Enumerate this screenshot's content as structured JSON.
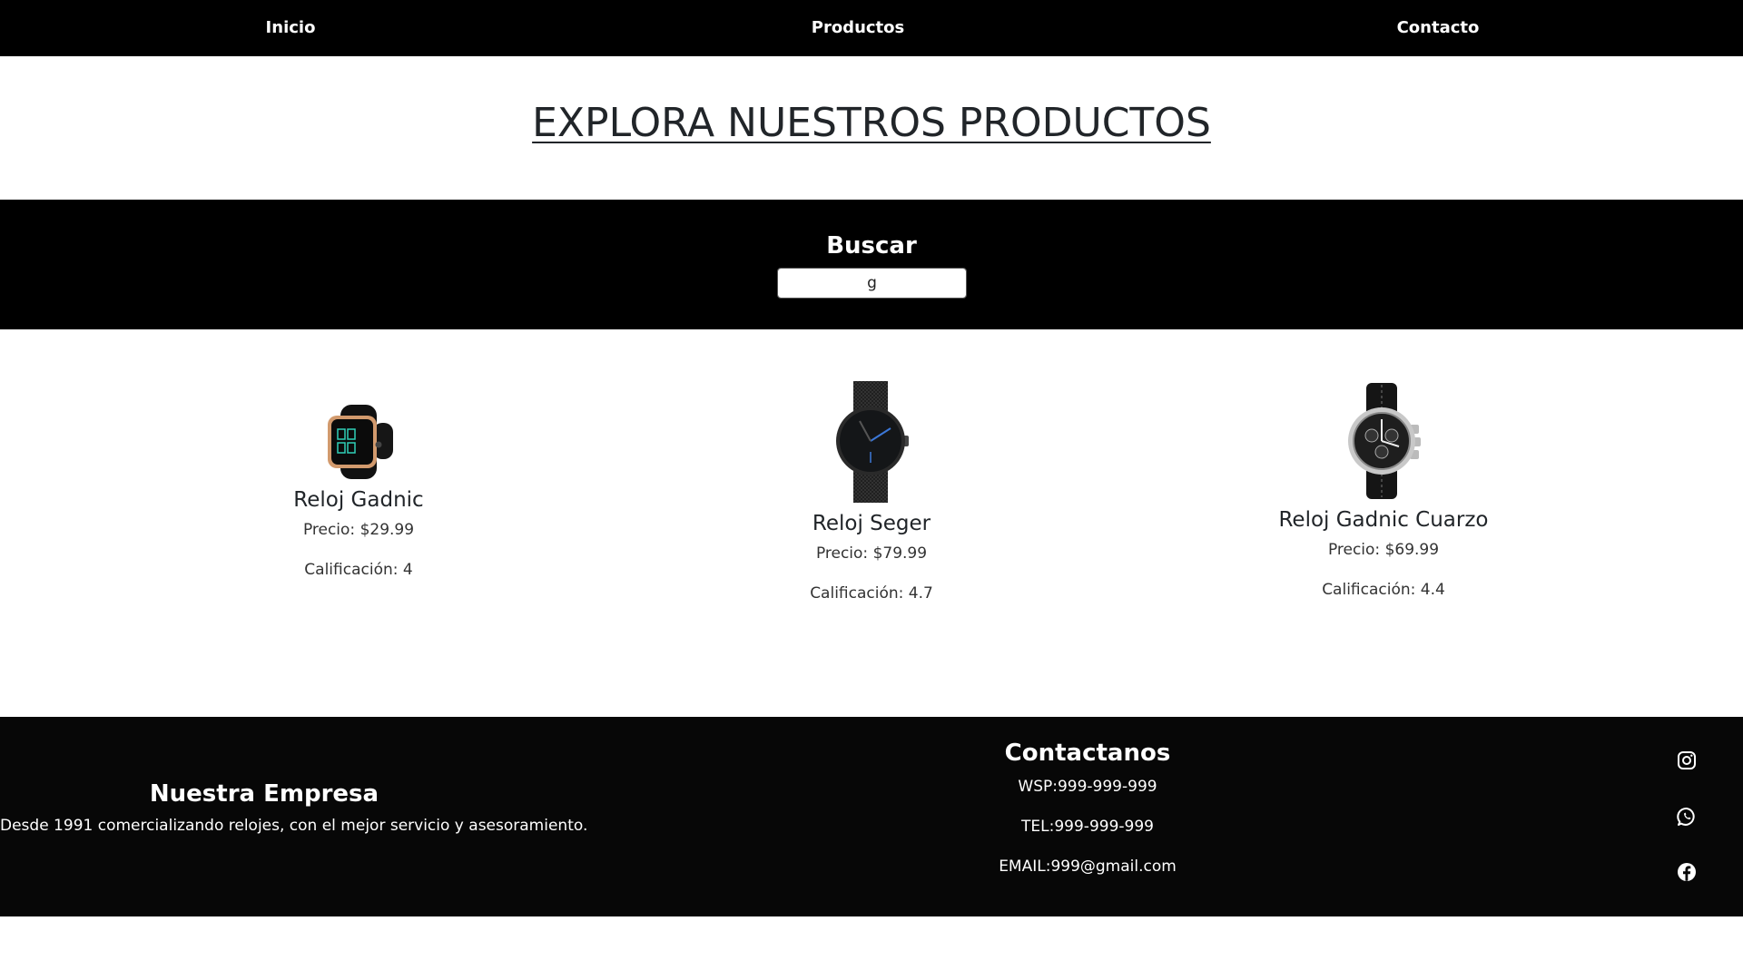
{
  "nav": {
    "items": [
      {
        "label": "Inicio"
      },
      {
        "label": "Productos"
      },
      {
        "label": "Contacto"
      }
    ]
  },
  "header": {
    "title": "EXPLORA NUESTROS PRODUCTOS"
  },
  "search": {
    "label": "Buscar",
    "value": "g"
  },
  "products": [
    {
      "name": "Reloj Gadnic",
      "price": "Precio: $29.99",
      "rating": "Calificación: 4",
      "image_icon": "smartwatch-icon"
    },
    {
      "name": "Reloj Seger",
      "price": "Precio: $79.99",
      "rating": "Calificación: 4.7",
      "image_icon": "mesh-watch-icon"
    },
    {
      "name": "Reloj Gadnic Cuarzo",
      "price": "Precio: $69.99",
      "rating": "Calificación: 4.4",
      "image_icon": "chronograph-watch-icon"
    }
  ],
  "footer": {
    "company": {
      "title": "Nuestra Empresa",
      "description": "Desde 1991 comercializando relojes, con el mejor servicio y asesoramiento."
    },
    "contact": {
      "title": "Contactanos",
      "lines": [
        "WSP:999-999-999",
        "TEL:999-999-999",
        "EMAIL:999@gmail.com"
      ]
    },
    "social": [
      "instagram-icon",
      "whatsapp-icon",
      "facebook-icon"
    ]
  },
  "colors": {
    "dark_band": "#000000",
    "footer_bg": "#070707",
    "text": "#212529"
  }
}
